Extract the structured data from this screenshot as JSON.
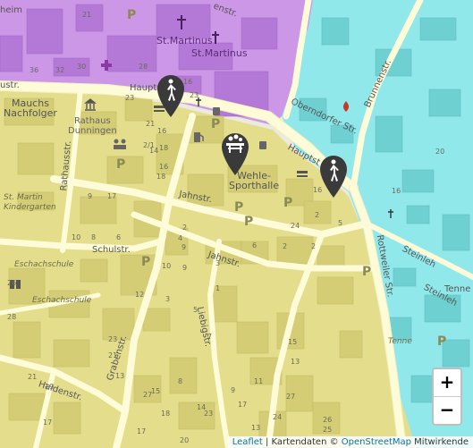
{
  "streets": {
    "hauptstr": "Hauptstr.",
    "hauptstr_left": "ustr.",
    "hauptstr_top": "Haupts",
    "hauptstr_right": "Hauptst",
    "brunnenstr": "Brunnenstr.",
    "oberndorfer": "Oberndorfer Str.",
    "rathausstr": "Rathausstr.",
    "jahnstr1": "Jahnstr.",
    "jahnstr2": "Jahnstr.",
    "schulstr": "Schulstr.",
    "grabenstr": "Grabenstr.",
    "liebigstr": "Liebigstr.",
    "haldenstr": "Haldenstr.",
    "rottweiler": "Rottweiler Str.",
    "steinleh1": "Steinleh",
    "steinleh2": "Steinleh",
    "tennstr_top": "Tenne",
    "tennstr": "Tenne",
    "heim": "heim",
    "enstr": "enstr."
  },
  "pois": {
    "st_martinus_1": "St.Martinus",
    "st_martinus_2": "St.Martinus",
    "mauchs": "Mauchs\nNachfolger",
    "rathaus": "Rathaus\nDunningen",
    "wehle": "Wehle-\nSporthalle",
    "st_martin_kg": "St. Martin\nKindergarten",
    "eschachschule1": "Eschachschule",
    "eschachschule2": "Eschachschule"
  },
  "house_numbers": [
    "21",
    "36",
    "32",
    "30",
    "28",
    "16",
    "23",
    "23",
    "21",
    "16",
    "18",
    "14",
    "2/1",
    "16",
    "18",
    "9",
    "17",
    "10",
    "8",
    "6",
    "9",
    "10",
    "9",
    "4",
    "2",
    "2",
    "5",
    "6",
    "2",
    "2",
    "1",
    "3",
    "3",
    "5",
    "7",
    "12",
    "15",
    "13",
    "11",
    "9",
    "13",
    "15",
    "17",
    "19",
    "21",
    "23",
    "26",
    "25",
    "27",
    "17",
    "18",
    "20",
    "23",
    "13",
    "24",
    "27",
    "28",
    "26",
    "21",
    "8",
    "14",
    "17",
    "15",
    "16",
    "24",
    "16",
    "20"
  ],
  "parking_label": "P",
  "markers": [
    {
      "name": "pedestrian-marker-1",
      "icon": "pedestrian-icon"
    },
    {
      "name": "picnic-marker",
      "icon": "picnic-table-icon"
    },
    {
      "name": "pedestrian-marker-2",
      "icon": "pedestrian-icon"
    }
  ],
  "zoom": {
    "in": "+",
    "out": "−"
  },
  "attribution": {
    "leaflet": "Leaflet",
    "sep": " | Kartendaten © ",
    "osm": "OpenStreetMap",
    "suffix": " Mitwirkende"
  },
  "colors": {
    "purple_zone": "#c58ae6",
    "cyan_zone": "#8ee6e6",
    "yellow_zone": "#e3dc8a",
    "road": "#fdfbdc",
    "marker": "#3a3a3a"
  }
}
